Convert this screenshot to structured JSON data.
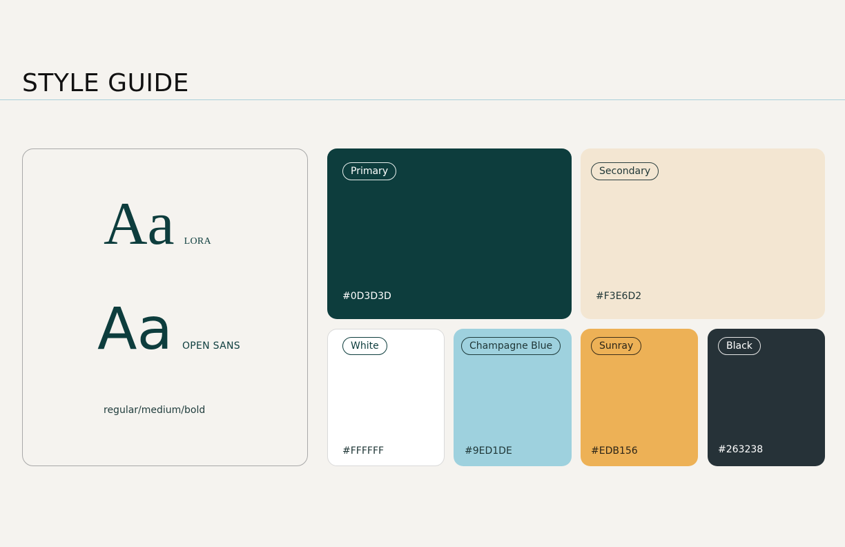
{
  "header": {
    "title": "STYLE GUIDE"
  },
  "typography": {
    "serif": {
      "sample": "Aa",
      "font_label": "LORA"
    },
    "sans": {
      "sample": "Aa",
      "font_label": "OPEN SANS"
    },
    "weights": "regular/medium/bold"
  },
  "swatches": [
    {
      "name": "Primary",
      "hex": "#0D3D3D",
      "color": "#0D3D3D"
    },
    {
      "name": "Secondary",
      "hex": "#F3E6D2",
      "color": "#F3E6D2"
    },
    {
      "name": "White",
      "hex": "#FFFFFF",
      "color": "#FFFFFF"
    },
    {
      "name": "Champagne Blue",
      "hex": "#9ED1DE",
      "color": "#9ED1DE"
    },
    {
      "name": "Sunray",
      "hex": "#EDB156",
      "color": "#EDB156"
    },
    {
      "name": "Black",
      "hex": "#263238",
      "color": "#263238"
    }
  ]
}
